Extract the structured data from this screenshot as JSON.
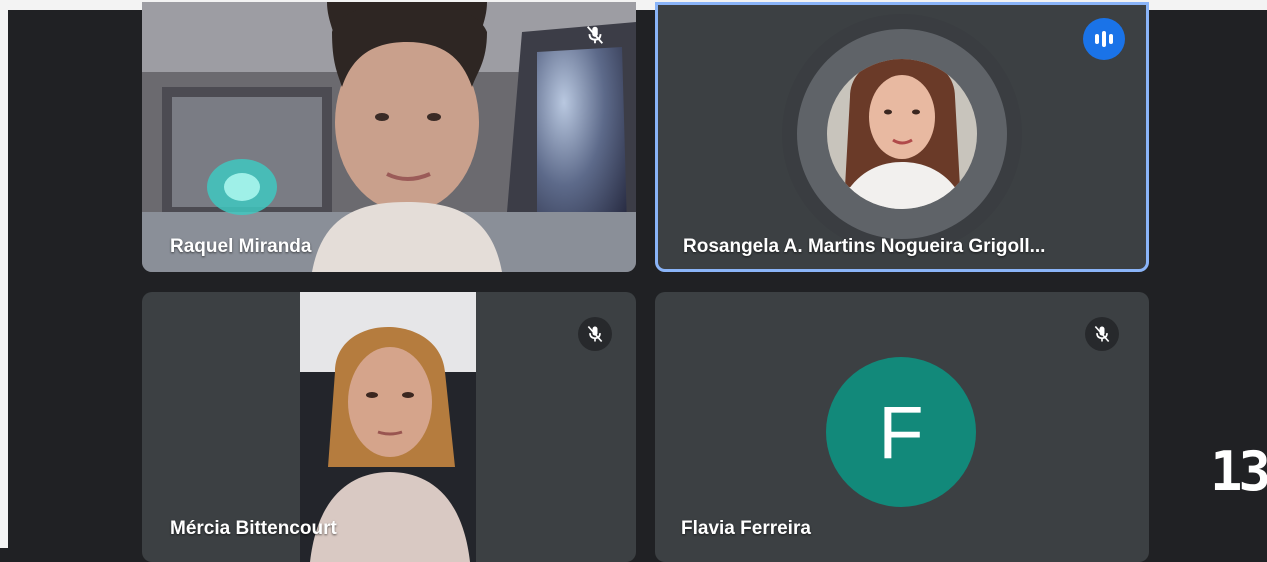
{
  "participants": [
    {
      "name": "Raquel Miranda",
      "mic": "muted"
    },
    {
      "name": "Rosangela A. Martins Nogueira Grigoll...",
      "mic": "speaking"
    },
    {
      "name": "Mércia Bittencourt",
      "mic": "muted"
    },
    {
      "name": "Flavia Ferreira",
      "mic": "muted",
      "avatar_letter": "F",
      "avatar_color": "#12897a"
    }
  ],
  "overlay": {
    "corner_text": "13"
  },
  "colors": {
    "tile": "#3c4043",
    "background": "#202124",
    "active_border": "#8ab4f8",
    "speaking": "#1a73e8"
  }
}
